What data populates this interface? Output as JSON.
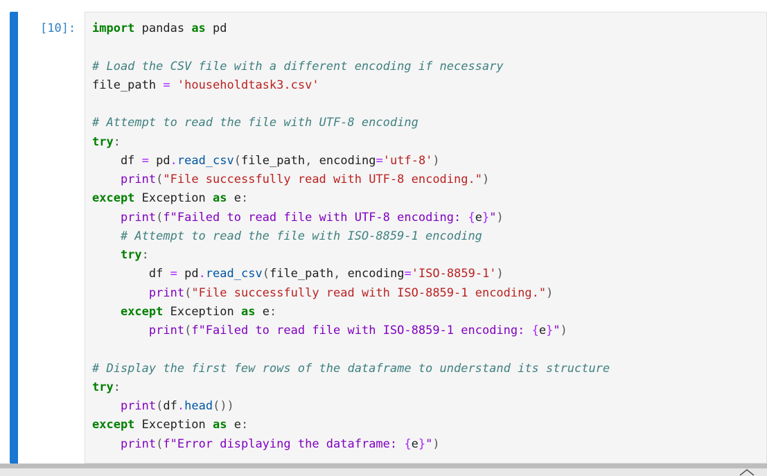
{
  "cell": {
    "prompt": "[10]:",
    "accent_color": "#1976d2",
    "lines": [
      [
        {
          "t": "import",
          "c": "kw"
        },
        {
          "t": " pandas ",
          "c": "nm"
        },
        {
          "t": "as",
          "c": "kw"
        },
        {
          "t": " pd",
          "c": "nm"
        }
      ],
      [],
      [
        {
          "t": "# Load the CSV file with a different encoding if necessary",
          "c": "cm"
        }
      ],
      [
        {
          "t": "file_path ",
          "c": "nm"
        },
        {
          "t": "=",
          "c": "op"
        },
        {
          "t": " ",
          "c": "nm"
        },
        {
          "t": "'householdtask3.csv'",
          "c": "st"
        }
      ],
      [],
      [
        {
          "t": "# Attempt to read the file with UTF-8 encoding",
          "c": "cm"
        }
      ],
      [
        {
          "t": "try",
          "c": "kw"
        },
        {
          "t": ":",
          "c": "pu"
        }
      ],
      [
        {
          "t": "    df ",
          "c": "nm"
        },
        {
          "t": "=",
          "c": "op"
        },
        {
          "t": " pd",
          "c": "nm"
        },
        {
          "t": ".",
          "c": "op"
        },
        {
          "t": "read_csv",
          "c": "fn"
        },
        {
          "t": "(",
          "c": "pu"
        },
        {
          "t": "file_path",
          "c": "nm"
        },
        {
          "t": ",",
          "c": "pu"
        },
        {
          "t": " encoding",
          "c": "nm"
        },
        {
          "t": "=",
          "c": "op"
        },
        {
          "t": "'utf-8'",
          "c": "st"
        },
        {
          "t": ")",
          "c": "pu"
        }
      ],
      [
        {
          "t": "    ",
          "c": "nm"
        },
        {
          "t": "print",
          "c": "bi"
        },
        {
          "t": "(",
          "c": "pu"
        },
        {
          "t": "\"File successfully read with UTF-8 encoding.\"",
          "c": "st"
        },
        {
          "t": ")",
          "c": "pu"
        }
      ],
      [
        {
          "t": "except",
          "c": "kw"
        },
        {
          "t": " Exception ",
          "c": "nm"
        },
        {
          "t": "as",
          "c": "kw"
        },
        {
          "t": " e",
          "c": "nm"
        },
        {
          "t": ":",
          "c": "pu"
        }
      ],
      [
        {
          "t": "    ",
          "c": "nm"
        },
        {
          "t": "print",
          "c": "bi"
        },
        {
          "t": "(",
          "c": "pu"
        },
        {
          "t": "f\"Failed to read file with UTF-8 encoding: ",
          "c": "bi"
        },
        {
          "t": "{",
          "c": "op"
        },
        {
          "t": "e",
          "c": "nm"
        },
        {
          "t": "}",
          "c": "op"
        },
        {
          "t": "\"",
          "c": "bi"
        },
        {
          "t": ")",
          "c": "pu"
        }
      ],
      [
        {
          "t": "    # Attempt to read the file with ISO-8859-1 encoding",
          "c": "cm"
        }
      ],
      [
        {
          "t": "    ",
          "c": "nm"
        },
        {
          "t": "try",
          "c": "kw"
        },
        {
          "t": ":",
          "c": "pu"
        }
      ],
      [
        {
          "t": "        df ",
          "c": "nm"
        },
        {
          "t": "=",
          "c": "op"
        },
        {
          "t": " pd",
          "c": "nm"
        },
        {
          "t": ".",
          "c": "op"
        },
        {
          "t": "read_csv",
          "c": "fn"
        },
        {
          "t": "(",
          "c": "pu"
        },
        {
          "t": "file_path",
          "c": "nm"
        },
        {
          "t": ",",
          "c": "pu"
        },
        {
          "t": " encoding",
          "c": "nm"
        },
        {
          "t": "=",
          "c": "op"
        },
        {
          "t": "'ISO-8859-1'",
          "c": "st"
        },
        {
          "t": ")",
          "c": "pu"
        }
      ],
      [
        {
          "t": "        ",
          "c": "nm"
        },
        {
          "t": "print",
          "c": "bi"
        },
        {
          "t": "(",
          "c": "pu"
        },
        {
          "t": "\"File successfully read with ISO-8859-1 encoding.\"",
          "c": "st"
        },
        {
          "t": ")",
          "c": "pu"
        }
      ],
      [
        {
          "t": "    ",
          "c": "nm"
        },
        {
          "t": "except",
          "c": "kw"
        },
        {
          "t": " Exception ",
          "c": "nm"
        },
        {
          "t": "as",
          "c": "kw"
        },
        {
          "t": " e",
          "c": "nm"
        },
        {
          "t": ":",
          "c": "pu"
        }
      ],
      [
        {
          "t": "        ",
          "c": "nm"
        },
        {
          "t": "print",
          "c": "bi"
        },
        {
          "t": "(",
          "c": "pu"
        },
        {
          "t": "f\"Failed to read file with ISO-8859-1 encoding: ",
          "c": "bi"
        },
        {
          "t": "{",
          "c": "op"
        },
        {
          "t": "e",
          "c": "nm"
        },
        {
          "t": "}",
          "c": "op"
        },
        {
          "t": "\"",
          "c": "bi"
        },
        {
          "t": ")",
          "c": "pu"
        }
      ],
      [],
      [
        {
          "t": "# Display the first few rows of the dataframe to understand its structure",
          "c": "cm"
        }
      ],
      [
        {
          "t": "try",
          "c": "kw"
        },
        {
          "t": ":",
          "c": "pu"
        }
      ],
      [
        {
          "t": "    ",
          "c": "nm"
        },
        {
          "t": "print",
          "c": "bi"
        },
        {
          "t": "(",
          "c": "pu"
        },
        {
          "t": "df",
          "c": "nm"
        },
        {
          "t": ".",
          "c": "op"
        },
        {
          "t": "head",
          "c": "fn"
        },
        {
          "t": "())",
          "c": "pu"
        }
      ],
      [
        {
          "t": "except",
          "c": "kw"
        },
        {
          "t": " Exception ",
          "c": "nm"
        },
        {
          "t": "as",
          "c": "kw"
        },
        {
          "t": " e",
          "c": "nm"
        },
        {
          "t": ":",
          "c": "pu"
        }
      ],
      [
        {
          "t": "    ",
          "c": "nm"
        },
        {
          "t": "print",
          "c": "bi"
        },
        {
          "t": "(",
          "c": "pu"
        },
        {
          "t": "f\"Error displaying the dataframe: ",
          "c": "bi"
        },
        {
          "t": "{",
          "c": "op"
        },
        {
          "t": "e",
          "c": "nm"
        },
        {
          "t": "}",
          "c": "op"
        },
        {
          "t": "\"",
          "c": "bi"
        },
        {
          "t": ")",
          "c": "pu"
        }
      ]
    ]
  },
  "footer": {
    "icon": "chevron-up-icon"
  }
}
